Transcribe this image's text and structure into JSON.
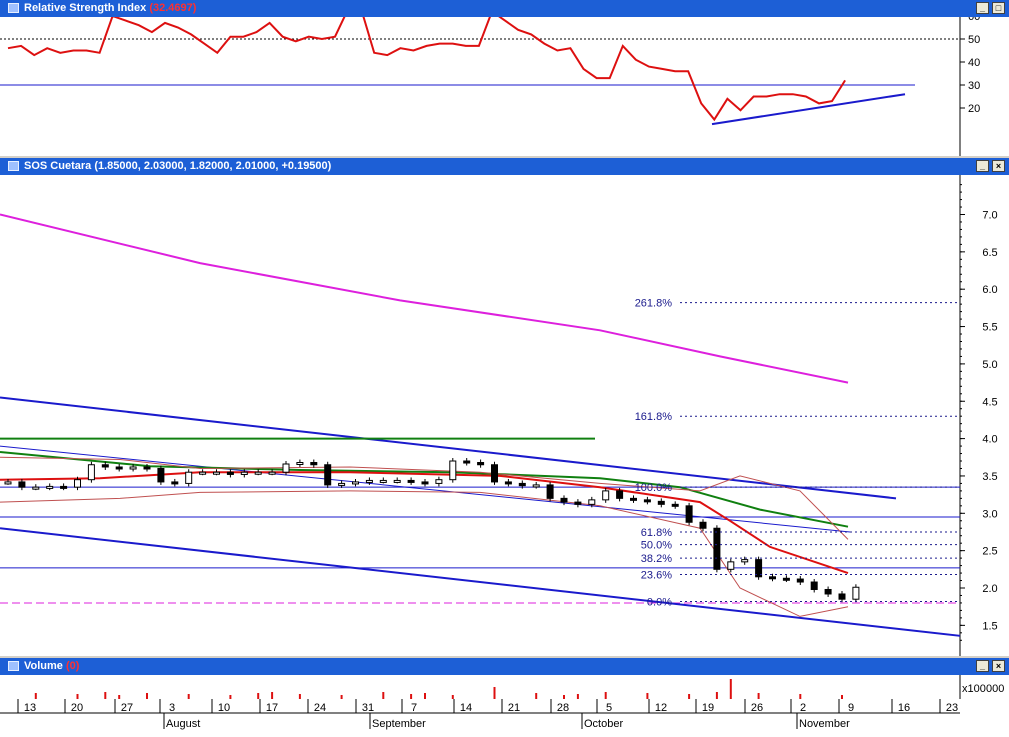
{
  "panes": {
    "rsi": {
      "title": "Relative Strength Index",
      "value": "(32.4697)"
    },
    "price": {
      "title": "SOS Cuetara",
      "value": "(1.85000, 2.03000, 1.82000, 2.01000, +0.19500)"
    },
    "volume": {
      "title": "Volume",
      "value": "(0)"
    }
  },
  "window_buttons": [
    "_",
    "□",
    "×"
  ],
  "colors": {
    "titlebar": "#1d5fd6",
    "rsi_line": "#dd1010",
    "trend_blue": "#1a1acc",
    "magenta": "#dd20dd",
    "green_ma": "#108010",
    "red_ma": "#dd1010",
    "bollinger": "#c05050"
  },
  "rsi_axis": {
    "ticks": [
      "60",
      "50",
      "40",
      "30",
      "20"
    ]
  },
  "price_axis": {
    "ticks": [
      "7.0",
      "6.5",
      "6.0",
      "5.5",
      "5.0",
      "4.5",
      "4.0",
      "3.5",
      "3.0",
      "2.5",
      "2.0",
      "1.5"
    ]
  },
  "volume_axis": {
    "label": "x100",
    "label2": "000"
  },
  "fibonacci": [
    "261.8%",
    "161.8%",
    "100.0%",
    "61.8%",
    "50.0%",
    "38.2%",
    "23.6%",
    "0.0%"
  ],
  "x_axis": {
    "days": [
      "13",
      "20",
      "27",
      "3",
      "10",
      "17",
      "24",
      "31",
      "7",
      "14",
      "21",
      "28",
      "5",
      "12",
      "19",
      "26",
      "2",
      "9",
      "16",
      "23"
    ],
    "months": [
      "August",
      "September",
      "October",
      "November"
    ]
  },
  "chart_data": {
    "type": "line",
    "title": "SOS Cuetara",
    "series": [
      {
        "name": "Relative Strength Index",
        "values": [
          46,
          47,
          43,
          46,
          44,
          45,
          45,
          44,
          60,
          58,
          56,
          53,
          57,
          55,
          52,
          48,
          44,
          51,
          51,
          53,
          57,
          51,
          49,
          51,
          50,
          51,
          63,
          63,
          44,
          43,
          46,
          45,
          47,
          48,
          48,
          47,
          47,
          62,
          58,
          54,
          52,
          48,
          45,
          46,
          37,
          33,
          33,
          47,
          41,
          38,
          37,
          36,
          36,
          22,
          15,
          24,
          19,
          25,
          25,
          26,
          26,
          25,
          22,
          23,
          32
        ]
      },
      {
        "name": "SOS Cuetara",
        "values": [
          3.42,
          3.35,
          3.35,
          3.36,
          3.35,
          3.45,
          3.65,
          3.62,
          3.6,
          3.62,
          3.6,
          3.42,
          3.4,
          3.55,
          3.55,
          3.55,
          3.52,
          3.55,
          3.55,
          3.55,
          3.66,
          3.68,
          3.65,
          3.38,
          3.4,
          3.42,
          3.44,
          3.44,
          3.44,
          3.42,
          3.4,
          3.45,
          3.7,
          3.68,
          3.65,
          3.42,
          3.4,
          3.37,
          3.38,
          3.2,
          3.15,
          3.12,
          3.18,
          3.3,
          3.2,
          3.18,
          3.16,
          3.12,
          3.1,
          2.88,
          2.8,
          2.25,
          2.35,
          2.38,
          2.15,
          2.13,
          2.12,
          2.08,
          1.98,
          1.92,
          1.85,
          2.01
        ]
      }
    ],
    "ylim": [
      1.3,
      7.4
    ]
  }
}
